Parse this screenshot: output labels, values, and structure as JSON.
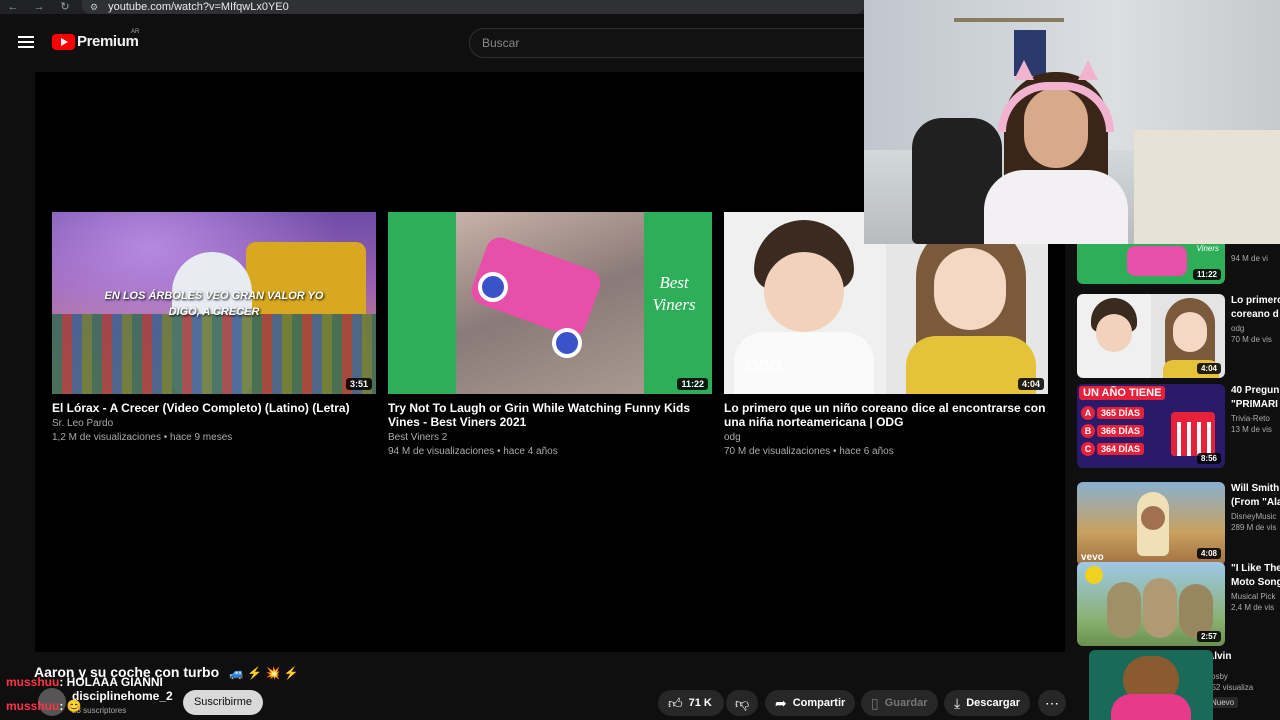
{
  "browser": {
    "url": "youtube.com/watch?v=MIfqwLx0YE0"
  },
  "header": {
    "logo_text": "Premium",
    "region": "AR",
    "search_placeholder": "Buscar"
  },
  "endscreen": [
    {
      "title": "El Lórax - A Crecer (Video Completo) (Latino) (Letra)",
      "channel": "Sr. Leo Pardo",
      "meta": "1,2 M de visualizaciones • hace 9 meses",
      "duration": "3:51",
      "caption": "EN LOS ÁRBOLES VEO GRAN VALOR YO DIGO, A CRECER"
    },
    {
      "title": "Try Not To Laugh or Grin While Watching Funny Kids Vines - Best Viners 2021",
      "channel": "Best Viners 2",
      "meta": "94 M de visualizaciones • hace 4 años",
      "duration": "11:22",
      "brand": "Best Viners"
    },
    {
      "title": "Lo primero que un niño coreano dice al encontrarse con una niña norteamericana | ODG",
      "channel": "odg",
      "meta": "70 M de visualizaciones • hace 6 años",
      "duration": "4:04",
      "watermark": "ODG"
    }
  ],
  "sidebar": [
    {
      "title": "",
      "title2": "Viners",
      "channel": "",
      "meta": "94 M de vi",
      "duration": "11:22"
    },
    {
      "title": "Lo primero",
      "title2": "coreano d",
      "channel": "odg",
      "meta": "70 M de vis",
      "duration": "4:04"
    },
    {
      "title": "40 Pregun",
      "title2": "\"PRIMARI",
      "channel": "Trivia-Reto",
      "meta": "13 M de vis",
      "duration": "8:56",
      "banner": "UN AÑO TIENE",
      "options": [
        {
          "letter": "A",
          "text": "365 DÍAS"
        },
        {
          "letter": "B",
          "text": "366 DÍAS"
        },
        {
          "letter": "C",
          "text": "364 DÍAS"
        }
      ]
    },
    {
      "title": "Will Smith",
      "title2": "(From \"Ala",
      "channel": "DisneyMusic",
      "meta": "289 M de vis",
      "duration": "4:08",
      "label": "vevo"
    },
    {
      "title": "\"I Like The",
      "title2": "Moto Song",
      "channel": "Musical Pick",
      "meta": "2,4 M de vis",
      "duration": "2:57"
    },
    {
      "title": "Alvin",
      "title2": "",
      "channel": "Josby",
      "meta": "152 visualiza",
      "duration": "",
      "badge": "Nuevo"
    }
  ],
  "now_playing": {
    "title": "Aaron y su coche con turbo",
    "emoji": "🚙 ⚡ 💥 ⚡",
    "channel": "disciplinehome_2",
    "subscribers": "23 suscriptores",
    "subscribe_label": "Suscribirme",
    "likes": "71 K",
    "share_label": "Compartir",
    "save_label": "Guardar",
    "download_label": "Descargar"
  },
  "chat": [
    {
      "user": "musshuu",
      "message": ": HOLAAA GIANNI"
    },
    {
      "user": "musshuu",
      "message": ": 😊"
    }
  ]
}
